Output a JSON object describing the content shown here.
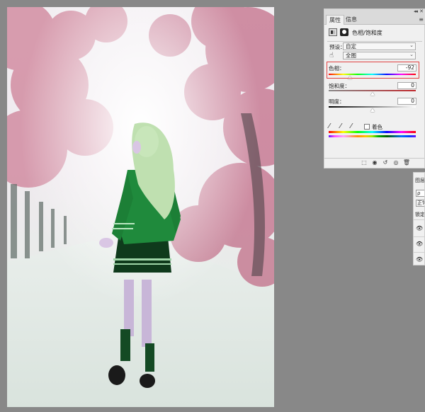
{
  "properties_panel": {
    "collapse_icon": "double-chevron",
    "close_icon": "x",
    "tabs": [
      {
        "label": "属性",
        "active": true
      },
      {
        "label": "信息",
        "active": false
      }
    ],
    "menu_icon": "hamburger",
    "adjustment_title": "色相/饱和度",
    "preset_label": "预设：",
    "preset_value": "自定",
    "channel_value": "全图",
    "hue": {
      "label": "色相：",
      "value": "-92",
      "level": 0.24
    },
    "saturation": {
      "label": "饱和度：",
      "value": "0",
      "level": 0.5
    },
    "lightness": {
      "label": "明度：",
      "value": "0",
      "level": 0.5
    },
    "colorize_label": "着色",
    "colorize_checked": false,
    "highlight_color": "#e04040"
  },
  "layers_panel": {
    "tab_label": "图层",
    "search_text": "ρ",
    "blend_mode": "正常",
    "lock_label": "锁定",
    "rows": 3
  },
  "canvas": {
    "description_colors": {
      "trees": "#c25a78",
      "uniform": "#1f8a3c",
      "hair": "#bfe0b0",
      "road": "#e6ece8"
    }
  }
}
